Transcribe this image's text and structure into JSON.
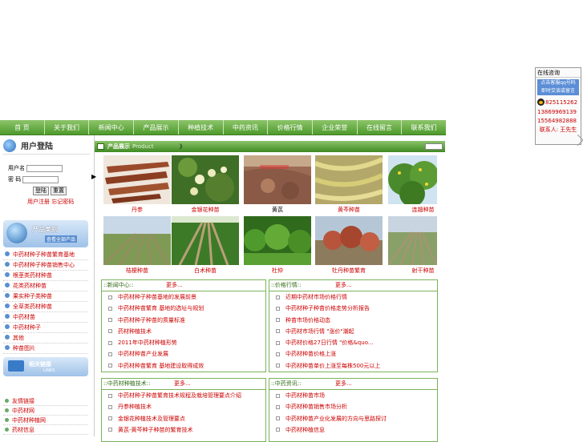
{
  "nav": [
    "首 页",
    "关于我们",
    "新闻中心",
    "产品展示",
    "种植技术",
    "中药资讯",
    "价格行情",
    "企业荣誉",
    "在线留言",
    "联系我们"
  ],
  "login": {
    "title": "用户登陆",
    "user_label": "用户名",
    "pass_label": "密 码",
    "submit": "登陆",
    "reset": "重置",
    "links": "用户注册  忘记密码"
  },
  "categories": {
    "title": "产品类别",
    "subtitle": "查看全部产品",
    "items": [
      "中药材种子种苗繁育基地",
      "中药材种子种苗销售中心",
      "根茎类药材种苗",
      "花类药材种苗",
      "果实种子类种苗",
      "全草类药材种苗",
      "中药材苗",
      "中药材种子",
      "其他",
      "种苗图片"
    ]
  },
  "friend_links": {
    "title": "相关链接",
    "subtitle": "LINKS",
    "items": [
      "友情链接",
      "中药材网",
      "中药材种植网",
      "药材信息"
    ]
  },
  "products": {
    "title": "产品展示",
    "title_en": "Product",
    "marker": "》",
    "row1": [
      "丹参",
      "金银花种苗",
      "黄芪",
      "黄芩种苗",
      "连翘种苗"
    ],
    "row2": [
      "桔梗种苗",
      "白术种苗",
      "杜仲",
      "牡丹种苗繁育",
      "射干种苗"
    ]
  },
  "boxes": {
    "news": {
      "title": "::新闻中心::",
      "more": "更多...",
      "items": [
        "中药材种子种苗基地的发展前景",
        "中药材种苗繁育 基地的选址与规划",
        "中药材种子种苗的质量标准",
        "药材种植技术",
        "2011年中药材种植形势",
        "中药材种苗产业发展",
        "中药材种苗繁育 基地建设取得成效"
      ]
    },
    "prices": {
      "title": "::价格行情::",
      "more": "更多...",
      "items": [
        "近期中药材市场价格行情",
        "中药材种子种苗价格走势分析报告",
        "种苗市场价格动态",
        "中药材市场行情 \"涨价\"潮起",
        "中药材价格27日行情 \"价格&quo...",
        "中药材种苗价格上涨",
        "中药材种苗单价上涨至每株500元以上"
      ]
    },
    "tech": {
      "title": "::中药材种植技术::",
      "more": "更多...",
      "items": [
        "中药材种子种苗繁育技术规程及栽培管理要点介绍",
        "丹参种植技术",
        "金银花种植技术及管理要点",
        "黄芪-黄芩种子种苗的繁育技术"
      ]
    },
    "info": {
      "title": "::中药资讯::",
      "more": "更多...",
      "items": [
        "中药材种苗市场",
        "中药材种苗销售市场分析",
        "中药材种苗产业化发展的方向与思路探讨",
        "中药材种植信息"
      ]
    }
  },
  "online": {
    "title": "在线咨询",
    "banner_line1": "点击客服qq号码",
    "banner_line2": "即时交谈或留言",
    "qq": "825115262",
    "tel1": "13869969139",
    "tel2": "15564982888",
    "footer": "联系人: 王先生"
  }
}
